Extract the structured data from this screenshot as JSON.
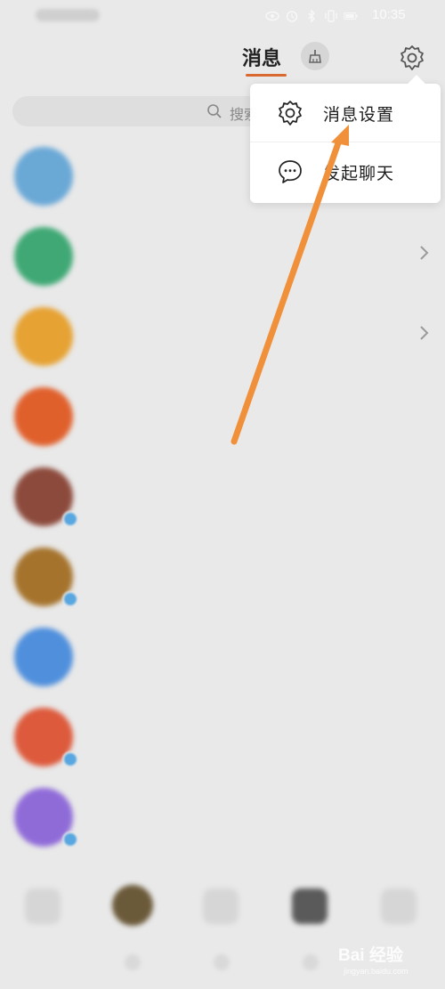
{
  "status_bar": {
    "time": "10:35",
    "icons": [
      "eye-icon",
      "alarm-icon",
      "bluetooth-icon",
      "vibrate-icon",
      "battery-icon"
    ]
  },
  "top_nav": {
    "left_label": "",
    "tabs": [
      {
        "label": "",
        "active": false
      },
      {
        "label": "消息",
        "active": true
      }
    ],
    "broom_icon": "broom-icon",
    "settings_icon": "gear-icon",
    "accent_color": "#d9692f"
  },
  "search": {
    "placeholder": "搜索"
  },
  "conversations": [
    {
      "avatar_color": "#6aa8d6",
      "name": "",
      "preview": "",
      "time": "",
      "chevron": false,
      "badge": false
    },
    {
      "avatar_color": "#3fa874",
      "name": "",
      "preview": "",
      "time": "",
      "chevron": true,
      "badge": false
    },
    {
      "avatar_color": "#e6a233",
      "name": "",
      "preview": "",
      "time": "",
      "chevron": true,
      "badge": false
    },
    {
      "avatar_color": "#e0602c",
      "name": "",
      "preview": "",
      "time": "",
      "chevron": false,
      "badge": false
    },
    {
      "avatar_color": "#8c4a3c",
      "name": "",
      "preview": "",
      "time": "",
      "chevron": false,
      "badge": true
    },
    {
      "avatar_color": "#a5732c",
      "name": "",
      "preview": "",
      "time": "",
      "chevron": false,
      "badge": true
    },
    {
      "avatar_color": "#4f8fdc",
      "name": "",
      "preview": "",
      "time": "",
      "chevron": false,
      "badge": false
    },
    {
      "avatar_color": "#dd5a3c",
      "name": "",
      "preview": "",
      "time": "",
      "chevron": false,
      "badge": true
    },
    {
      "avatar_color": "#8f6bd8",
      "name": "",
      "preview": "",
      "time": "",
      "chevron": false,
      "badge": true
    }
  ],
  "popup_menu": {
    "items": [
      {
        "label": "消息设置",
        "icon": "gear-icon"
      },
      {
        "label": "发起聊天",
        "icon": "chat-bubble-icon"
      }
    ]
  },
  "bottom_tabs": [
    {
      "icon": "home-icon",
      "color": "#d6d6d6"
    },
    {
      "icon": "profile-avatar-icon",
      "color": "#6b5a3a"
    },
    {
      "icon": "discover-icon",
      "color": "#d6d6d6"
    },
    {
      "icon": "message-icon",
      "color": "#5a5a5a"
    },
    {
      "icon": "me-icon",
      "color": "#d6d6d6"
    }
  ],
  "annotation": {
    "arrow_color": "#f0903a"
  },
  "watermark": {
    "text": "Bai 经验",
    "sub": "jingyan.baidu.com"
  }
}
